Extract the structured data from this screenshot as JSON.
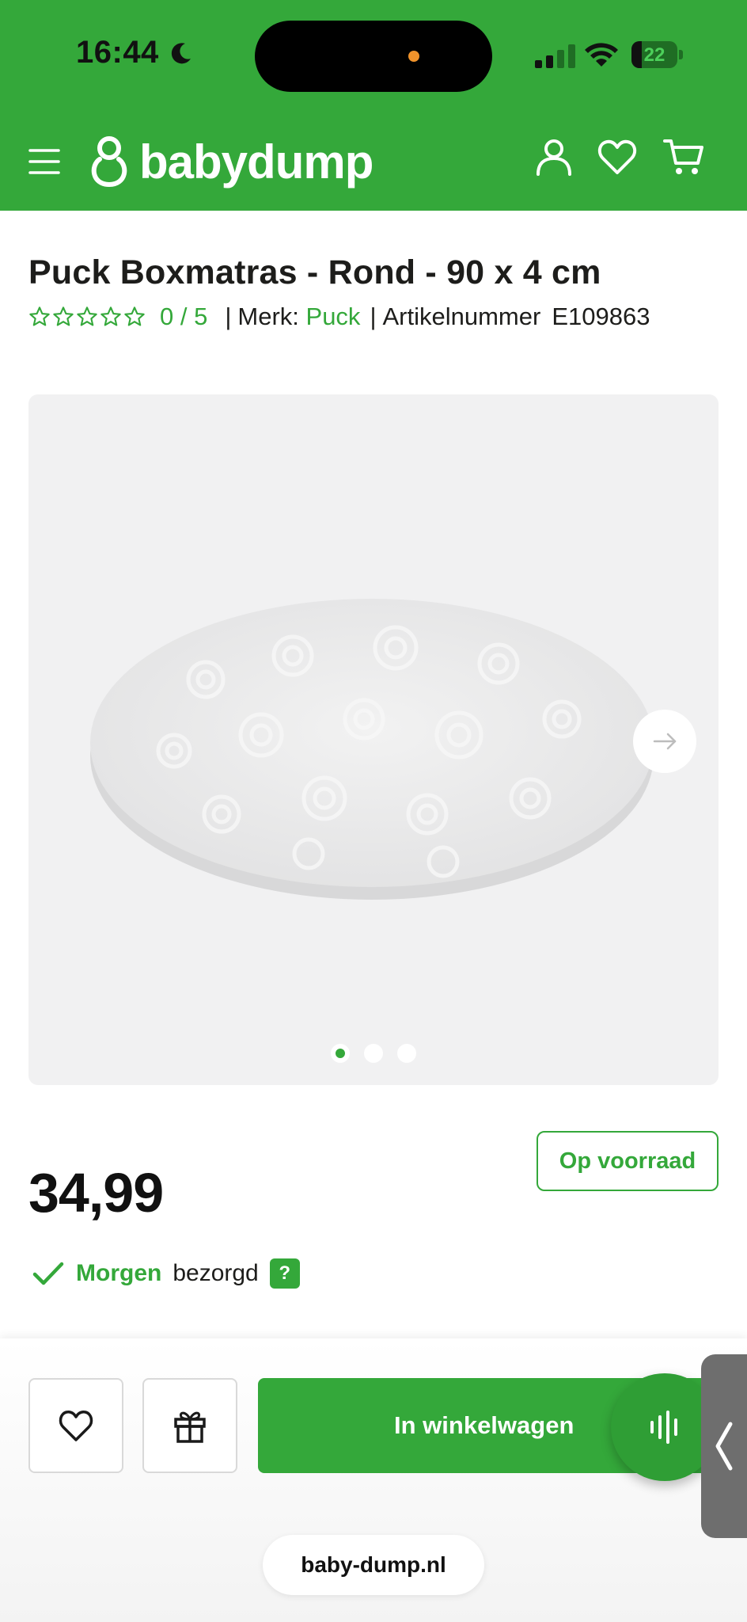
{
  "status_bar": {
    "time": "16:44",
    "battery": "22",
    "battery_level": 0.22,
    "icons": [
      "moon-icon",
      "signal-icon",
      "wifi-icon",
      "battery-icon"
    ]
  },
  "header": {
    "logo_text": "babydump",
    "icons": [
      "menu-icon",
      "account-icon",
      "wishlist-icon",
      "cart-icon"
    ]
  },
  "product": {
    "title": "Puck Boxmatras - Rond - 90 x 4 cm",
    "rating_text": "0 / 5",
    "rating_stars": 0,
    "rating_max": 5,
    "brand_label": "Merk:",
    "brand": "Puck",
    "sku_label": "Artikelnummer",
    "sku": "E109863"
  },
  "gallery": {
    "image_count": 3,
    "active_index": 0
  },
  "pricing": {
    "stock_status": "Op voorraad",
    "price": "34,99",
    "delivery_highlight": "Morgen",
    "delivery_text": "bezorgd",
    "help_label": "?"
  },
  "actions": {
    "add_to_cart_label": "In winkelwagen"
  },
  "browser": {
    "url": "baby-dump.nl"
  },
  "colors": {
    "brand_green": "#34a83a",
    "text_dark": "#1d1d1b",
    "gallery_bg": "#f1f1f2"
  }
}
